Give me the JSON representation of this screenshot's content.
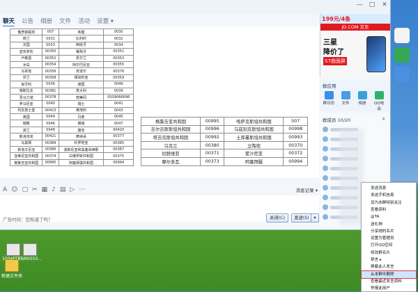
{
  "tabs": [
    "聊天",
    "公告",
    "相册",
    "文件",
    "活动",
    "设置 ▾"
  ],
  "window_buttons": [
    "—",
    "□",
    "✕"
  ],
  "table_left": [
    [
      "俄罗斯联邦",
      "007",
      "希腊",
      "0030"
    ],
    [
      "荷兰",
      "0031",
      "比利时",
      "0032"
    ],
    [
      "法国",
      "0033",
      "西班牙",
      "0034"
    ],
    [
      "直布罗陀",
      "00350",
      "葡萄牙",
      "00351"
    ],
    [
      "卢森堡",
      "00352",
      "爱尔兰",
      "00353"
    ],
    [
      "冰岛",
      "00354",
      "阿尔巴尼亚",
      "00355"
    ],
    [
      "马耳他",
      "00356",
      "安道尔",
      "00376"
    ],
    [
      "芬兰",
      "00358",
      "保加利亚",
      "00359"
    ],
    [
      "匈牙利",
      "0036",
      "德国",
      "0049"
    ],
    [
      "南斯拉夫",
      "00381",
      "意大利",
      "0039"
    ],
    [
      "圣马力诺",
      "00378",
      "梵蒂冈",
      "0039066698"
    ],
    [
      "罗马尼亚",
      "0040",
      "瑞士",
      "0041"
    ],
    [
      "列支敦士登",
      "00423",
      "奥地利",
      "0043"
    ],
    [
      "英国",
      "0044",
      "丹麦",
      "0045"
    ],
    [
      "瑞典",
      "0046",
      "挪威",
      "0047"
    ],
    [
      "波兰",
      "0048",
      "捷克",
      "00420"
    ],
    [
      "斯洛伐克",
      "00421",
      "摩纳哥",
      "00377"
    ],
    [
      "马其顿",
      "00389",
      "科罗地亚",
      "00385"
    ],
    [
      "斯洛文尼亚",
      "00386",
      "波斯尼亚和黑塞哥维那",
      "00387"
    ],
    [
      "亚美尼亚共和国",
      "00374",
      "白俄罗斯共和国",
      "00375"
    ],
    [
      "格鲁吉亚共和国",
      "00995",
      "阿塞拜疆共和国",
      "00994"
    ]
  ],
  "table_right": [
    [
      "格鲁吉亚共和国",
      "00995",
      "哈萨克斯坦共和国",
      "007"
    ],
    [
      "吉尔吉斯斯坦共和国",
      "00996",
      "乌兹别克斯坦共和国",
      "00998"
    ],
    [
      "塔吉克斯坦共和国",
      "00992",
      "土库曼斯坦共和国",
      "00993"
    ],
    [
      "乌克兰",
      "00380",
      "立陶宛",
      "00370"
    ],
    [
      "拉脱维亚",
      "00371",
      "爱沙尼亚",
      "00372"
    ],
    [
      "摩尔多瓦",
      "00373",
      "阿塞拜疆",
      "00994"
    ]
  ],
  "toolbar": {
    "icons": [
      "A",
      "☺",
      "▢",
      "✂",
      "▦",
      "♪",
      "▤",
      "▷",
      "⋯"
    ],
    "message_log": "消息记录 ▾"
  },
  "input": {
    "hint": "广告时间：您知道了吗？",
    "close": "关闭(C)",
    "send": "发送(S)",
    "send_arrow": "▾"
  },
  "ad": {
    "price": "199元/4条",
    "brand": "JD.COM 京东",
    "banner": "",
    "line1": "三星",
    "line2": "降价了",
    "line3": "S7曲面屏"
  },
  "group_app": {
    "title": "群应用",
    "apps": [
      {
        "label": "群日历",
        "color": "#3b8ee8"
      },
      {
        "label": "文件",
        "color": "#4a9be6"
      },
      {
        "label": "相册",
        "color": "#39a0d8"
      },
      {
        "label": "QQ电话",
        "color": "#2fb36a"
      }
    ]
  },
  "members": {
    "title": "群成员 10/20",
    "search_icon": "search-icon",
    "count": 10
  },
  "context_menu": [
    "发送消息",
    "发送手机信息",
    "设为本群特别关注",
    "查看资料",
    "@TA",
    "送礼物",
    "分享她的名片",
    "设置为管理员",
    "打开QQ空间",
    "修改群名片",
    "禁言 ▸",
    "屏蔽此人发言",
    "从本群中删除",
    "查看最近发言资料",
    "举报此用户"
  ],
  "desktop_icons": [
    "1004PTE...",
    "TRM0550...",
    "新建文件夹"
  ]
}
